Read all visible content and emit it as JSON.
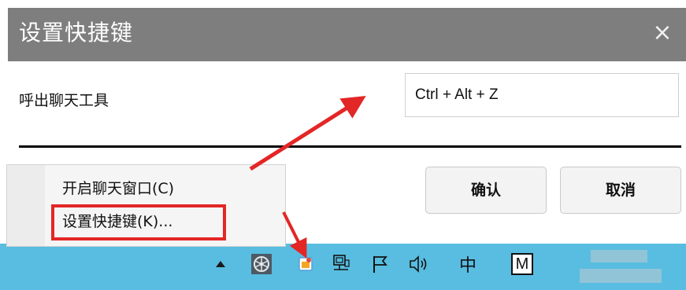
{
  "dialog": {
    "title": "设置快捷键",
    "close_glyph": "×",
    "label": "呼出聊天工具",
    "hotkey_value": "Ctrl + Alt + Z",
    "confirm_label": "确认",
    "cancel_label": "取消"
  },
  "context_menu": {
    "items": [
      {
        "label": "开启聊天窗口(C)"
      },
      {
        "label": "设置快捷键(K)..."
      }
    ]
  },
  "taskbar": {
    "ime_label": "中",
    "m_label": "M"
  },
  "colors": {
    "titlebar": "#7e7e7e",
    "taskbar": "#58bde0",
    "annotation_red": "#e32626"
  }
}
